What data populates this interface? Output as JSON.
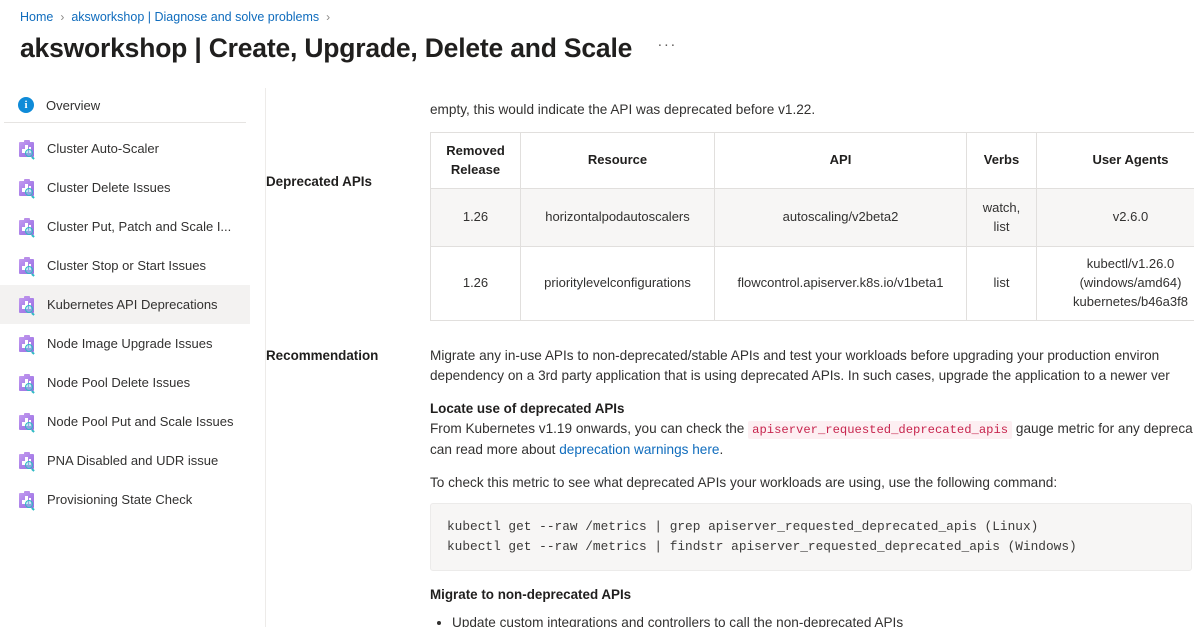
{
  "breadcrumb": {
    "items": [
      "Home",
      "aksworkshop | Diagnose and solve problems"
    ],
    "separator": "›"
  },
  "header": {
    "title": "aksworkshop | Create, Upgrade, Delete and Scale",
    "more_menu": "···"
  },
  "sidebar": {
    "overview": {
      "label": "Overview",
      "icon": "info-icon",
      "glyph": "i"
    },
    "items": [
      {
        "label": "Cluster Auto-Scaler",
        "selected": false
      },
      {
        "label": "Cluster Delete Issues",
        "selected": false
      },
      {
        "label": "Cluster Put, Patch and Scale I...",
        "selected": false
      },
      {
        "label": "Cluster Stop or Start Issues",
        "selected": false
      },
      {
        "label": "Kubernetes API Deprecations",
        "selected": true
      },
      {
        "label": "Node Image Upgrade Issues",
        "selected": false
      },
      {
        "label": "Node Pool Delete Issues",
        "selected": false
      },
      {
        "label": "Node Pool Put and Scale Issues",
        "selected": false
      },
      {
        "label": "PNA Disabled and UDR issue",
        "selected": false
      },
      {
        "label": "Provisioning State Check",
        "selected": false
      }
    ],
    "scroll_up_icon": "scroll-up-arrow-icon"
  },
  "content": {
    "lead_text": "empty, this would indicate the API was deprecated before v1.22.",
    "deprecated_apis": {
      "label": "Deprecated APIs",
      "columns": [
        "Removed Release",
        "Resource",
        "API",
        "Verbs",
        "User Agents",
        ""
      ],
      "rows": [
        {
          "removed_release": "1.26",
          "resource": "horizontalpodautoscalers",
          "api": "autoscaling/v2beta2",
          "verbs": "watch, list",
          "user_agents": "v2.6.0",
          "extra": ""
        },
        {
          "removed_release": "1.26",
          "resource": "prioritylevelconfigurations",
          "api": "flowcontrol.apiserver.k8s.io/v1beta1",
          "verbs": "list",
          "user_agents": "kubectl/v1.26.0 (windows/amd64) kubernetes/b46a3f8",
          "extra": ""
        }
      ]
    },
    "recommendation": {
      "label": "Recommendation",
      "paragraph_line1": "Migrate any in-use APIs to non-deprecated/stable APIs and test your workloads before upgrading your production environ",
      "paragraph_line2": "dependency on a 3rd party application that is using deprecated APIs. In such cases, upgrade the application to a newer ver",
      "locate_heading": "Locate use of deprecated APIs",
      "locate_line1_pre": "From Kubernetes v1.19 onwards, you can check the ",
      "locate_metric_code": "apiserver_requested_deprecated_apis",
      "locate_line1_post": " gauge metric for any depreca",
      "locate_line2_pre": "can read more about ",
      "locate_link": "deprecation warnings here",
      "locate_line2_post": ".",
      "check_metric_text": "To check this metric to see what deprecated APIs your workloads are using, use the following command:",
      "code_lines": [
        "kubectl get --raw /metrics | grep apiserver_requested_deprecated_apis (Linux)",
        "kubectl get --raw /metrics | findstr apiserver_requested_deprecated_apis (Windows)"
      ],
      "migrate_heading": "Migrate to non-deprecated APIs",
      "migrate_bullets": [
        "Update custom integrations and controllers to call the non-deprecated APIs"
      ]
    }
  },
  "colors": {
    "link": "#0f6cbd",
    "selected_nav": "#f3f2f1",
    "code_inline_text": "#c7254e",
    "code_inline_bg": "#fdeff2",
    "table_alt_row": "#f7f6f5",
    "table_border": "#e1dfdd",
    "icon_purple": "#a87ee8",
    "icon_teal": "#2fb9c4",
    "info_blue": "#0f8bd8"
  }
}
